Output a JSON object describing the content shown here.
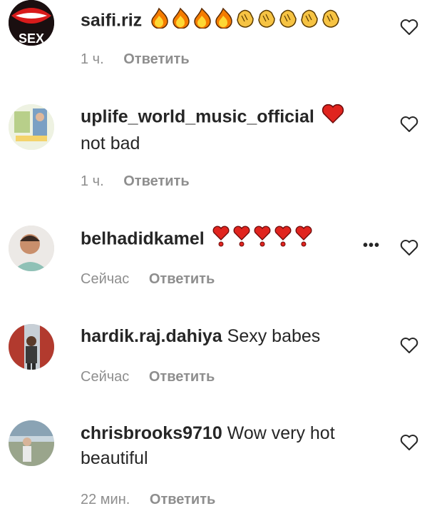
{
  "comments": [
    {
      "username": "saifi.riz",
      "text": "",
      "time": "1 ч.",
      "reply_label": "Ответить",
      "emoji": [
        "fire-emoji",
        "fire-emoji",
        "fire-emoji",
        "fire-emoji",
        "clap-emoji",
        "clap-emoji",
        "clap-emoji",
        "clap-emoji",
        "clap-emoji"
      ],
      "avatar_word": "SEX"
    },
    {
      "username": "uplife_world_music_official",
      "text": "not bad",
      "time": "1 ч.",
      "reply_label": "Ответить",
      "emoji": [
        "red-heart-emoji"
      ]
    },
    {
      "username": "belhadidkamel",
      "text": "",
      "time": "Сейчас",
      "reply_label": "Ответить",
      "emoji": [
        "heart-exclamation-emoji",
        "heart-exclamation-emoji",
        "heart-exclamation-emoji",
        "heart-exclamation-emoji",
        "heart-exclamation-emoji"
      ],
      "more_label": "•••"
    },
    {
      "username": "hardik.raj.dahiya",
      "text": "Sexy babes",
      "time": "Сейчас",
      "reply_label": "Ответить"
    },
    {
      "username": "chrisbrooks9710",
      "text": "Wow very hot beautiful",
      "time": "22 мин.",
      "reply_label": "Ответить"
    }
  ],
  "colors": {
    "text": "#262626",
    "meta": "#8e8e8e",
    "heart_red": "#e0241e",
    "fire": "#f57c00",
    "clap": "#f6c343"
  }
}
